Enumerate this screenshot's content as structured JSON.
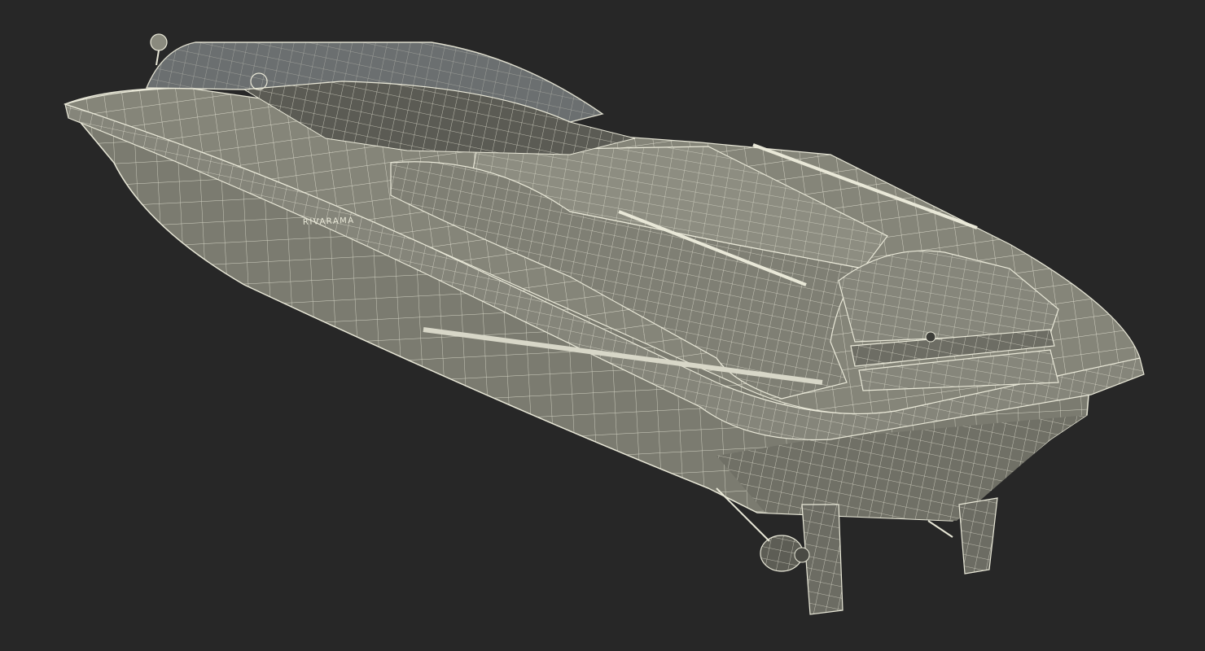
{
  "scene": {
    "background": "#272727",
    "hull_fill": "#7b7b70",
    "hull_shade": "#62625a",
    "deck_fill": "#8a8a7e",
    "wire_color": "#e9e8d8",
    "glass_fill": "#6f7374",
    "hull_text": "RIVARAMA"
  }
}
